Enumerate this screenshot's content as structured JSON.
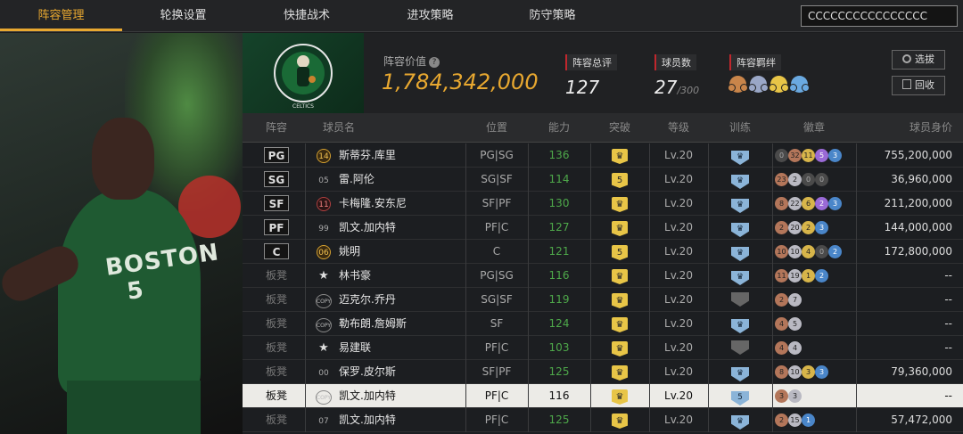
{
  "nav": {
    "tabs": [
      "阵容管理",
      "轮换设置",
      "快捷战术",
      "进攻策略",
      "防守策略"
    ],
    "active": 0,
    "account": "CCCCCCCCCCCCCCCC"
  },
  "header": {
    "team_logo": "BOSTON CELTICS",
    "value_label": "阵容价值",
    "value": "1,784,342,000",
    "rating_label": "阵容总评",
    "rating": "127",
    "count_label": "球员数",
    "count": "27",
    "count_max": "/300",
    "chem_label": "阵容羁绊",
    "chem_colors": [
      "#c9854a",
      "#9aa7c7",
      "#e8c547",
      "#6aa9e0"
    ],
    "select_btn": "选拔",
    "recycle_btn": "回收"
  },
  "columns": [
    "阵容",
    "球员名",
    "位置",
    "能力",
    "突破",
    "等级",
    "训练",
    "徽章",
    "球员身价"
  ],
  "rows": [
    {
      "pos": "PG",
      "bench": false,
      "num": "14",
      "numstyle": "gold",
      "name": "斯蒂芬.库里",
      "ps": "PG|SG",
      "ab": "136",
      "brk": "crown",
      "lv": "Lv.20",
      "train": "crown",
      "badges": [
        [
          "0",
          "dk"
        ],
        [
          "32",
          "br"
        ],
        [
          "11",
          "gd"
        ],
        [
          "5",
          "pu"
        ],
        [
          "3",
          "bl"
        ]
      ],
      "price": "755,200,000",
      "sel": false
    },
    {
      "pos": "SG",
      "bench": false,
      "num": "05",
      "numstyle": "plain",
      "name": "雷.阿伦",
      "ps": "SG|SF",
      "ab": "114",
      "brk": "5",
      "lv": "Lv.20",
      "train": "crown",
      "badges": [
        [
          "23",
          "br"
        ],
        [
          "2",
          "sl"
        ],
        [
          "0",
          "dk"
        ],
        [
          "0",
          "dk"
        ]
      ],
      "price": "36,960,000",
      "sel": false
    },
    {
      "pos": "SF",
      "bench": false,
      "num": "11",
      "numstyle": "red",
      "name": "卡梅隆.安东尼",
      "ps": "SF|PF",
      "ab": "130",
      "brk": "crown",
      "lv": "Lv.20",
      "train": "crown",
      "badges": [
        [
          "8",
          "br"
        ],
        [
          "22",
          "sl"
        ],
        [
          "6",
          "gd"
        ],
        [
          "2",
          "pu"
        ],
        [
          "3",
          "bl"
        ]
      ],
      "price": "211,200,000",
      "sel": false
    },
    {
      "pos": "PF",
      "bench": false,
      "num": "99",
      "numstyle": "plain",
      "name": "凯文.加内特",
      "ps": "PF|C",
      "ab": "127",
      "brk": "crown",
      "lv": "Lv.20",
      "train": "crown",
      "badges": [
        [
          "2",
          "br"
        ],
        [
          "20",
          "sl"
        ],
        [
          "2",
          "gd"
        ],
        [
          "3",
          "bl"
        ]
      ],
      "price": "144,000,000",
      "sel": false
    },
    {
      "pos": "C",
      "bench": false,
      "num": "06",
      "numstyle": "gold",
      "name": "姚明",
      "ps": "C",
      "ab": "121",
      "brk": "5",
      "lv": "Lv.20",
      "train": "crown",
      "badges": [
        [
          "10",
          "br"
        ],
        [
          "10",
          "sl"
        ],
        [
          "4",
          "gd"
        ],
        [
          "0",
          "dk"
        ],
        [
          "2",
          "bl"
        ]
      ],
      "price": "172,800,000",
      "sel": false
    },
    {
      "pos": "板凳",
      "bench": true,
      "num": "★",
      "numstyle": "star",
      "name": "林书豪",
      "ps": "PG|SG",
      "ab": "116",
      "brk": "crown",
      "lv": "Lv.20",
      "train": "crown",
      "badges": [
        [
          "11",
          "br"
        ],
        [
          "19",
          "sl"
        ],
        [
          "1",
          "gd"
        ],
        [
          "2",
          "bl"
        ]
      ],
      "price": "--",
      "sel": false
    },
    {
      "pos": "板凳",
      "bench": true,
      "num": "COPY",
      "numstyle": "copy",
      "name": "迈克尔.乔丹",
      "ps": "SG|SF",
      "ab": "119",
      "brk": "crown",
      "lv": "Lv.20",
      "train": "grey",
      "badges": [
        [
          "2",
          "br"
        ],
        [
          "7",
          "sl"
        ]
      ],
      "price": "--",
      "sel": false
    },
    {
      "pos": "板凳",
      "bench": true,
      "num": "COPY",
      "numstyle": "copy",
      "name": "勒布朗.詹姆斯",
      "ps": "SF",
      "ab": "124",
      "brk": "crown",
      "lv": "Lv.20",
      "train": "crown",
      "badges": [
        [
          "4",
          "br"
        ],
        [
          "5",
          "sl"
        ]
      ],
      "price": "--",
      "sel": false
    },
    {
      "pos": "板凳",
      "bench": true,
      "num": "★",
      "numstyle": "star",
      "name": "易建联",
      "ps": "PF|C",
      "ab": "103",
      "brk": "crown",
      "lv": "Lv.20",
      "train": "grey",
      "badges": [
        [
          "4",
          "br"
        ],
        [
          "4",
          "sl"
        ]
      ],
      "price": "--",
      "sel": false
    },
    {
      "pos": "板凳",
      "bench": true,
      "num": "00",
      "numstyle": "plain",
      "name": "保罗.皮尔斯",
      "ps": "SF|PF",
      "ab": "125",
      "brk": "crown",
      "lv": "Lv.20",
      "train": "crown",
      "badges": [
        [
          "8",
          "br"
        ],
        [
          "10",
          "sl"
        ],
        [
          "3",
          "gd"
        ],
        [
          "3",
          "bl"
        ]
      ],
      "price": "79,360,000",
      "sel": false
    },
    {
      "pos": "板凳",
      "bench": true,
      "num": "COPY",
      "numstyle": "copy",
      "name": "凯文.加内特",
      "ps": "PF|C",
      "ab": "116",
      "brk": "crown",
      "lv": "Lv.20",
      "train": "5",
      "badges": [
        [
          "3",
          "br"
        ],
        [
          "3",
          "sl"
        ]
      ],
      "price": "--",
      "sel": true
    },
    {
      "pos": "板凳",
      "bench": true,
      "num": "07",
      "numstyle": "plain",
      "name": "凯文.加内特",
      "ps": "PF|C",
      "ab": "125",
      "brk": "crown",
      "lv": "Lv.20",
      "train": "crown",
      "badges": [
        [
          "2",
          "br"
        ],
        [
          "15",
          "sl"
        ],
        [
          "1",
          "bl"
        ]
      ],
      "price": "57,472,000",
      "sel": false
    }
  ]
}
